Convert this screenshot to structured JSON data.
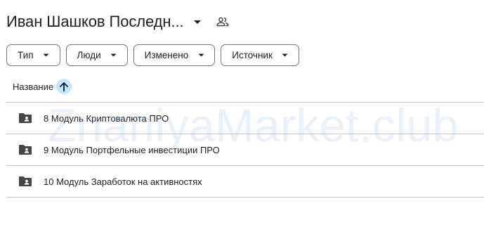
{
  "header": {
    "title": "Иван Шашков Последн...",
    "caret_icon": "arrow-drop-down-icon",
    "shared_icon": "people-icon"
  },
  "filters": [
    {
      "label": "Тип"
    },
    {
      "label": "Люди"
    },
    {
      "label": "Изменено"
    },
    {
      "label": "Источник"
    }
  ],
  "columns": {
    "name_label": "Название",
    "sort_icon": "arrow-upward-icon",
    "sort_color": "#c2e7ff"
  },
  "rows": [
    {
      "label": "8 Модуль Криптовалюта ПРО",
      "icon": "shared-folder-icon"
    },
    {
      "label": "9 Модуль Портфельные инвестиции ПРО",
      "icon": "shared-folder-icon"
    },
    {
      "label": "10 Модуль Заработок на активностях",
      "icon": "shared-folder-icon"
    }
  ],
  "watermark": "ZnaniyaMarket.club"
}
